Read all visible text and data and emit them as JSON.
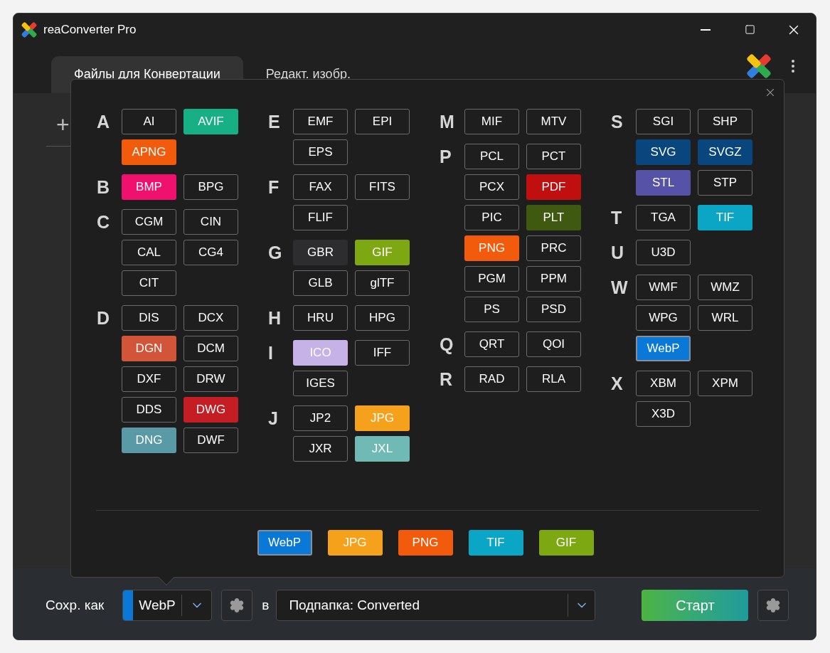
{
  "window": {
    "title": "reaConverter Pro"
  },
  "tabs": [
    {
      "label": "Файлы для Конвертации",
      "selected": true
    },
    {
      "label": "Редакт. изобр.",
      "selected": false
    }
  ],
  "add_button": {
    "label": "+"
  },
  "format_picker": {
    "columns": [
      {
        "groups": [
          {
            "letter": "A",
            "formats": [
              {
                "label": "AI",
                "selected": false
              },
              {
                "label": "AVIF",
                "color": "#17b085",
                "selected": false
              },
              {
                "label": "APNG",
                "color": "#f25a0c",
                "selected": false
              }
            ]
          },
          {
            "letter": "B",
            "formats": [
              {
                "label": "BMP",
                "color": "#f0106e",
                "selected": false
              },
              {
                "label": "BPG",
                "selected": false
              }
            ]
          },
          {
            "letter": "C",
            "formats": [
              {
                "label": "CGM",
                "selected": false
              },
              {
                "label": "CIN",
                "selected": false
              },
              {
                "label": "CAL",
                "selected": false
              },
              {
                "label": "CG4",
                "selected": false
              },
              {
                "label": "CIT",
                "selected": false
              }
            ]
          },
          {
            "letter": "D",
            "formats": [
              {
                "label": "DIS",
                "selected": false
              },
              {
                "label": "DCX",
                "selected": false
              },
              {
                "label": "DGN",
                "color": "#d2553a",
                "selected": false
              },
              {
                "label": "DCM",
                "selected": false
              },
              {
                "label": "DXF",
                "selected": false
              },
              {
                "label": "DRW",
                "selected": false
              },
              {
                "label": "DDS",
                "selected": false
              },
              {
                "label": "DWG",
                "color": "#c41e24",
                "selected": false
              },
              {
                "label": "DNG",
                "color": "#5a9aa6",
                "selected": false
              },
              {
                "label": "DWF",
                "selected": false
              }
            ]
          }
        ]
      },
      {
        "groups": [
          {
            "letter": "E",
            "formats": [
              {
                "label": "EMF",
                "selected": false
              },
              {
                "label": "EPI",
                "selected": false
              },
              {
                "label": "EPS",
                "selected": false
              }
            ]
          },
          {
            "letter": "F",
            "formats": [
              {
                "label": "FAX",
                "selected": false
              },
              {
                "label": "FITS",
                "selected": false
              },
              {
                "label": "FLIF",
                "selected": false
              }
            ]
          },
          {
            "letter": "G",
            "formats": [
              {
                "label": "GBR",
                "color": "#2d2d30",
                "selected": false
              },
              {
                "label": "GIF",
                "color": "#7ea812",
                "selected": false
              },
              {
                "label": "GLB",
                "selected": false
              },
              {
                "label": "glTF",
                "selected": false
              }
            ]
          },
          {
            "letter": "H",
            "formats": [
              {
                "label": "HRU",
                "selected": false
              },
              {
                "label": "HPG",
                "selected": false
              }
            ]
          },
          {
            "letter": "I",
            "formats": [
              {
                "label": "ICO",
                "color": "#c6b2e6",
                "selected": false
              },
              {
                "label": "IFF",
                "selected": false
              },
              {
                "label": "IGES",
                "selected": false
              }
            ]
          },
          {
            "letter": "J",
            "formats": [
              {
                "label": "JP2",
                "selected": false
              },
              {
                "label": "JPG",
                "color": "#f5a11b",
                "selected": false
              },
              {
                "label": "JXR",
                "selected": false
              },
              {
                "label": "JXL",
                "color": "#6fbab4",
                "selected": false
              }
            ]
          }
        ]
      },
      {
        "groups": [
          {
            "letter": "M",
            "formats": [
              {
                "label": "MIF",
                "selected": false
              },
              {
                "label": "MTV",
                "selected": false
              }
            ]
          },
          {
            "letter": "P",
            "formats": [
              {
                "label": "PCL",
                "selected": false
              },
              {
                "label": "PCT",
                "selected": false
              },
              {
                "label": "PCX",
                "selected": false
              },
              {
                "label": "PDF",
                "color": "#c00f0f",
                "selected": false
              },
              {
                "label": "PIC",
                "selected": false
              },
              {
                "label": "PLT",
                "color": "#3f5a10",
                "selected": false
              },
              {
                "label": "PNG",
                "color": "#f25a0c",
                "selected": false
              },
              {
                "label": "PRC",
                "selected": false
              },
              {
                "label": "PGM",
                "selected": false
              },
              {
                "label": "PPM",
                "selected": false
              },
              {
                "label": "PS",
                "selected": false
              },
              {
                "label": "PSD",
                "selected": false
              }
            ]
          },
          {
            "letter": "Q",
            "formats": [
              {
                "label": "QRT",
                "selected": false
              },
              {
                "label": "QOI",
                "selected": false
              }
            ]
          },
          {
            "letter": "R",
            "formats": [
              {
                "label": "RAD",
                "selected": false
              },
              {
                "label": "RLA",
                "selected": false
              }
            ]
          }
        ]
      },
      {
        "groups": [
          {
            "letter": "S",
            "formats": [
              {
                "label": "SGI",
                "selected": false
              },
              {
                "label": "SHP",
                "selected": false
              },
              {
                "label": "SVG",
                "color": "#0a467e",
                "selected": false
              },
              {
                "label": "SVGZ",
                "color": "#0a467e",
                "selected": false
              },
              {
                "label": "STL",
                "color": "#5552a8",
                "selected": false
              },
              {
                "label": "STP",
                "selected": false
              }
            ]
          },
          {
            "letter": "T",
            "formats": [
              {
                "label": "TGA",
                "selected": false
              },
              {
                "label": "TIF",
                "color": "#0ba5c5",
                "selected": false
              }
            ]
          },
          {
            "letter": "U",
            "formats": [
              {
                "label": "U3D",
                "selected": false
              }
            ]
          },
          {
            "letter": "W",
            "formats": [
              {
                "label": "WMF",
                "selected": false
              },
              {
                "label": "WMZ",
                "selected": false
              },
              {
                "label": "WPG",
                "selected": false
              },
              {
                "label": "WRL",
                "selected": false
              },
              {
                "label": "WebP",
                "color": "#0a78d7",
                "selected": true
              }
            ]
          },
          {
            "letter": "X",
            "formats": [
              {
                "label": "XBM",
                "selected": false
              },
              {
                "label": "XPM",
                "selected": false
              },
              {
                "label": "X3D",
                "selected": false
              }
            ]
          }
        ]
      }
    ],
    "quick_formats": [
      {
        "label": "WebP",
        "color": "#0a78d7",
        "selected": true
      },
      {
        "label": "JPG",
        "color": "#f5a11b",
        "selected": false
      },
      {
        "label": "PNG",
        "color": "#f25a0c",
        "selected": false
      },
      {
        "label": "TIF",
        "color": "#0ba5c5",
        "selected": false
      },
      {
        "label": "GIF",
        "color": "#7ea812",
        "selected": false
      }
    ]
  },
  "bottom_bar": {
    "save_as_label": "Сохр. как",
    "format": {
      "value": "WebP",
      "color": "#0a78d7"
    },
    "in_label": "в",
    "folder": {
      "value": "Подпапка: Converted"
    },
    "start_button": "Старт"
  }
}
